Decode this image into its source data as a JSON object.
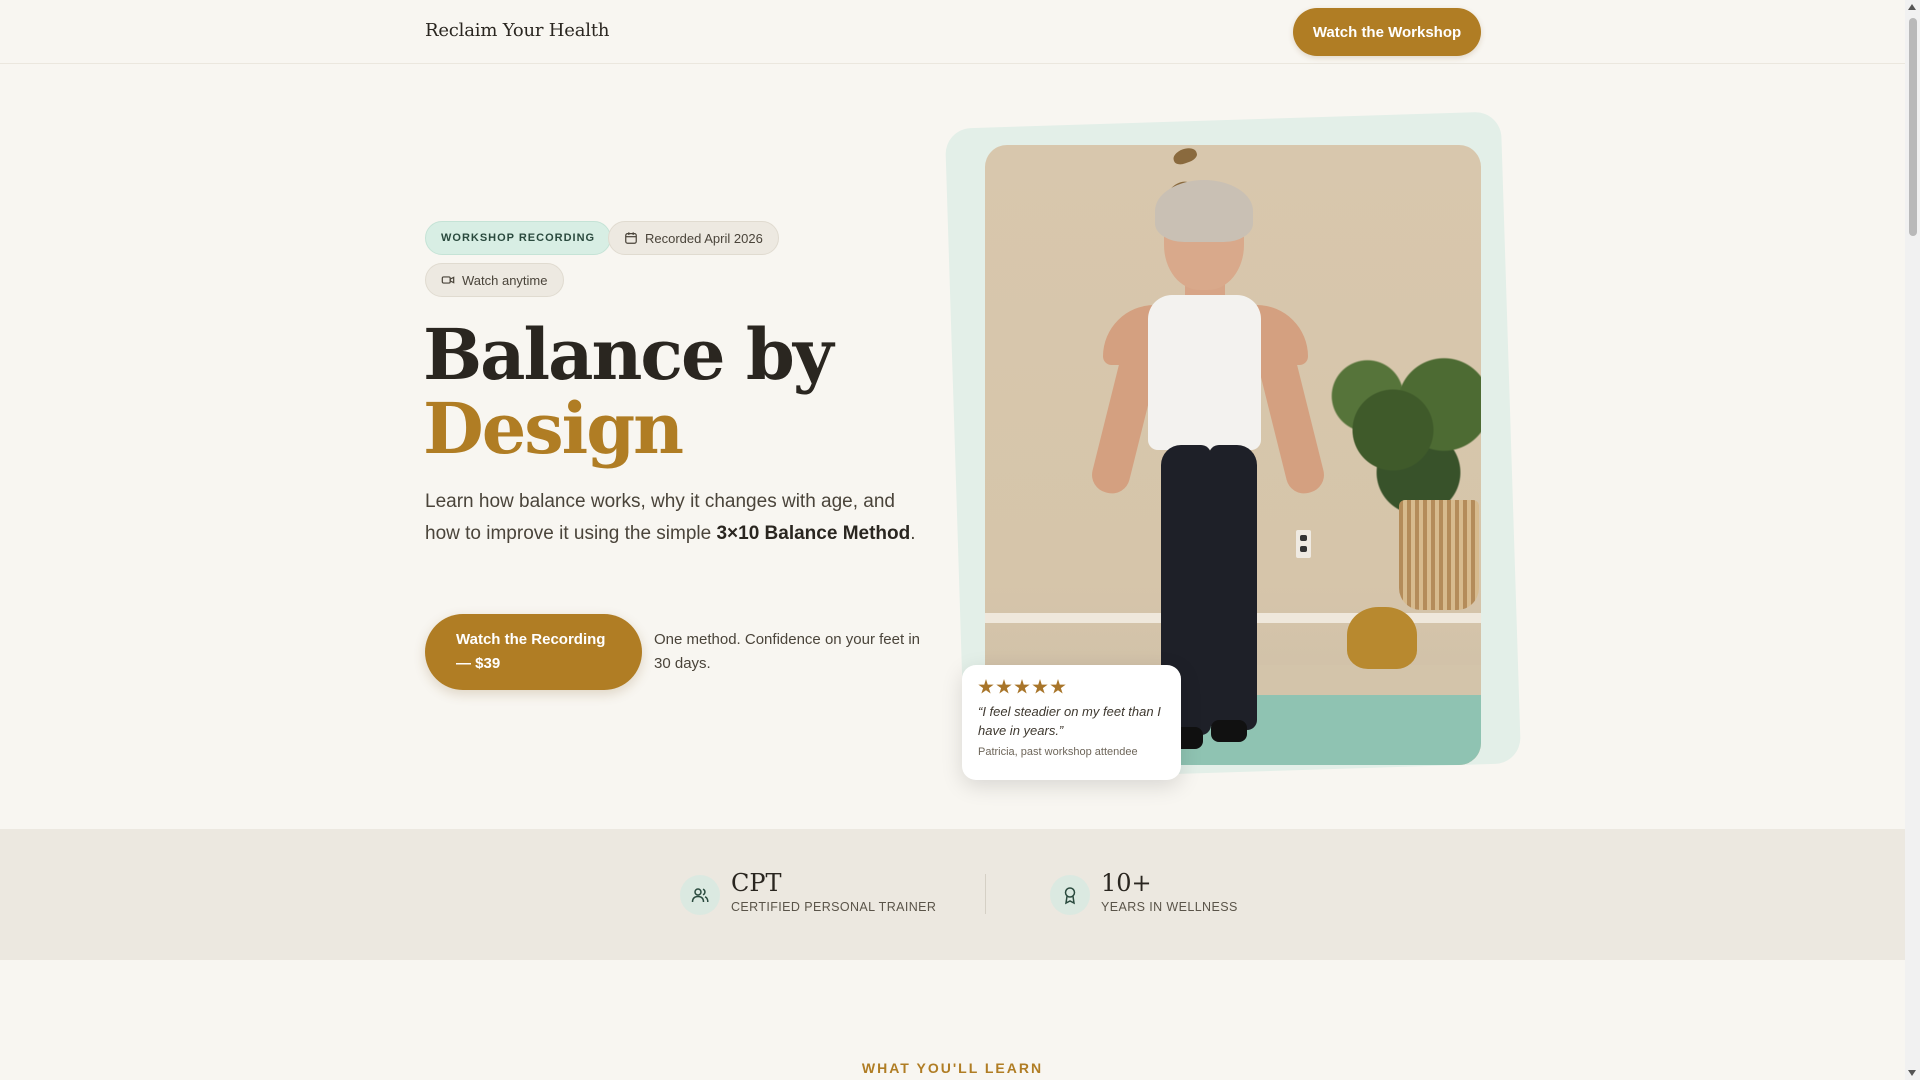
{
  "header": {
    "brand": "Reclaim Your Health",
    "cta_label": "Watch the Workshop"
  },
  "hero": {
    "badges": {
      "workshop": "WORKSHOP RECORDING",
      "recorded": "Recorded April 2026",
      "watch": "Watch anytime"
    },
    "headline_line1": "Balance by",
    "headline_line2": "Design",
    "subhead_before": "Learn how balance works, why it changes with age, and how to improve it using the simple ",
    "subhead_bold": "3×10 Balance Method",
    "subhead_after": ".",
    "cta_label": "Watch the Recording — $39",
    "cta_note": "One method. Confidence on your feet in 30 days."
  },
  "testimonial": {
    "rating": 5,
    "quote": "“I feel steadier on my feet than I have in years.”",
    "attribution": "Patricia, past workshop attendee"
  },
  "stats": [
    {
      "icon": "users-icon",
      "value": "CPT",
      "label": "CERTIFIED PERSONAL TRAINER"
    },
    {
      "icon": "award-icon",
      "value": "10+",
      "label": "YEARS IN WELLNESS"
    }
  ],
  "next_section": {
    "eyebrow": "WHAT YOU'LL LEARN"
  },
  "colors": {
    "accent": "#b07d24",
    "background": "#f8f6f1",
    "mint": "#d8eee4",
    "band": "#ece8e0"
  }
}
